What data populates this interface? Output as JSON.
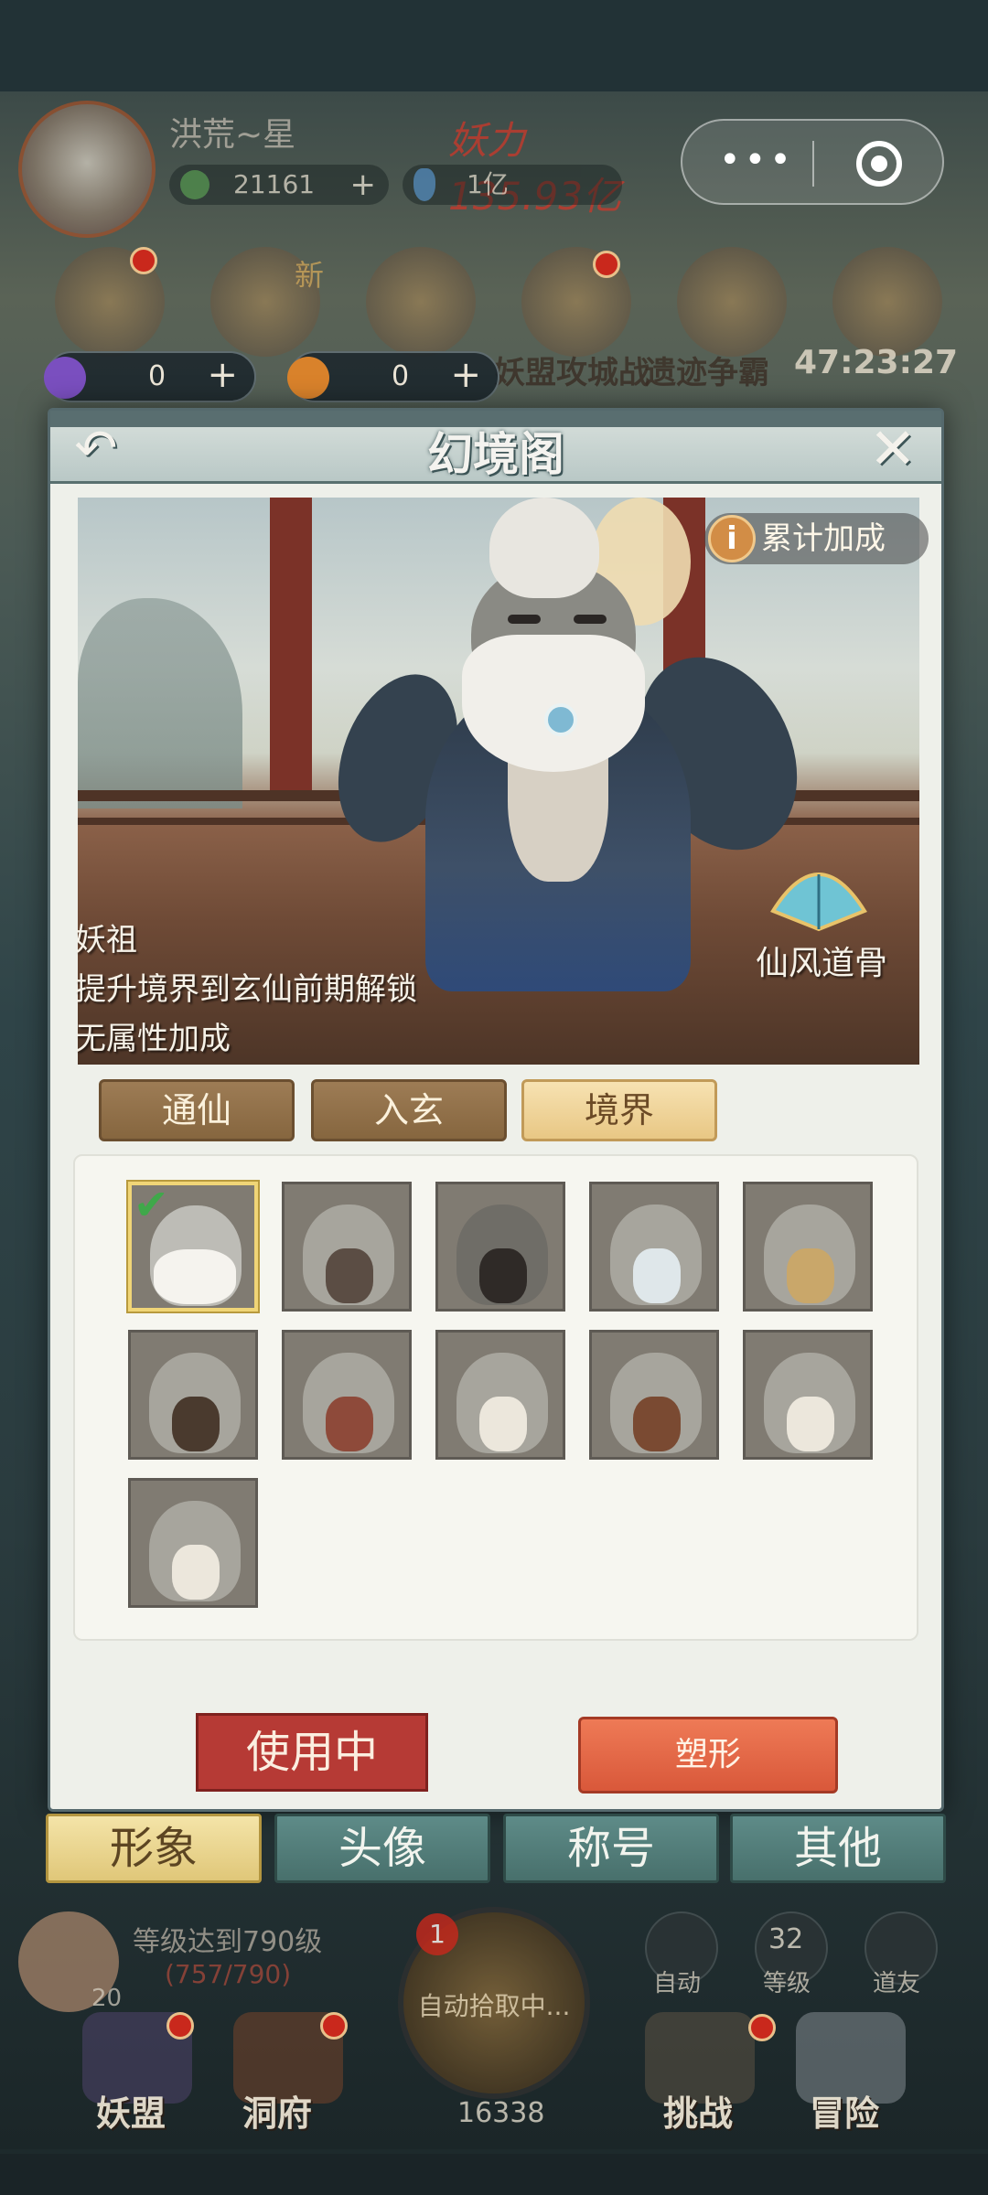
{
  "status": {
    "player_name": "洪荒~星",
    "power": "妖力 135.93亿",
    "coins": "21161",
    "gems": "1亿"
  },
  "events": {
    "labels": [
      "新",
      "妖盟攻城战",
      "遗迹争霸"
    ],
    "timer": "47:23:27"
  },
  "currencies": [
    {
      "value": "0",
      "color": "#7a4fbf"
    },
    {
      "value": "0",
      "color": "#d9822b"
    }
  ],
  "dialog": {
    "title": "幻境阁",
    "bonus_label": "累计加成",
    "form_name": "妖祖",
    "unlock_text": "提升境界到玄仙前期解锁",
    "attribute_text": "无属性加成",
    "effect_name": "仙风道骨",
    "category_tabs": [
      "通仙",
      "入玄",
      "境界"
    ],
    "active_category": "境界",
    "use_button": "使用中",
    "reshape_button": "塑形"
  },
  "bottom_tabs": [
    "形象",
    "头像",
    "称号",
    "其他"
  ],
  "active_bottom_tab": "形象",
  "hud": {
    "level_goal": "等级达到790级",
    "level_progress": "(757/790)",
    "level_num": "20",
    "auto_badge": "1",
    "auto_text": "自动拾取中...",
    "auto_label": "自动",
    "grade_num": "32",
    "grade_label": "等级",
    "friends_label": "道友",
    "coin_total": "16338",
    "nav": [
      "妖盟",
      "洞府",
      "挑战",
      "冒险"
    ]
  }
}
